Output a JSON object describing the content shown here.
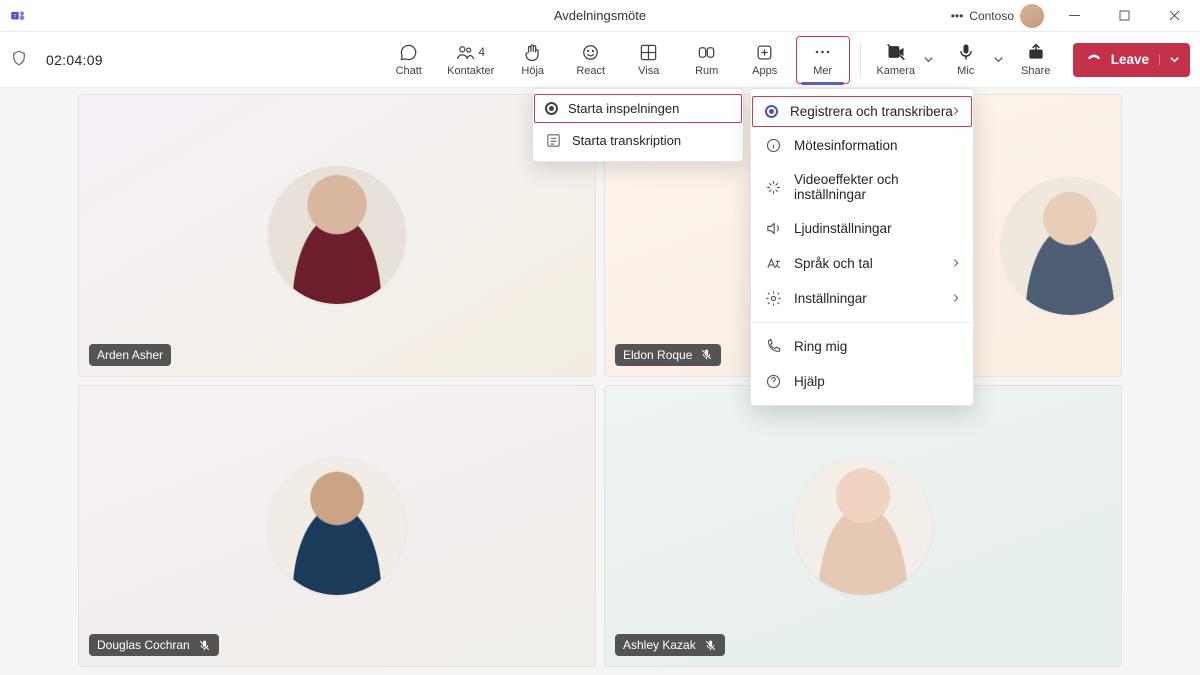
{
  "title": "Avdelningsmöte",
  "org": "Contoso",
  "timer": "02:04:09",
  "toolbar": {
    "chat": "Chatt",
    "people": "Kontakter",
    "people_count": "4",
    "raise": "Höja",
    "react": "React",
    "view": "Visa",
    "rooms": "Rum",
    "apps": "Apps",
    "more": "Mer",
    "camera": "Kamera",
    "mic": "Mic",
    "share": "Share",
    "leave": "Leave"
  },
  "submenu": {
    "start_recording": "Starta inspelningen",
    "start_transcription": "Starta transkription"
  },
  "menu": {
    "record_transcribe": "Registrera och transkribera",
    "meeting_info": "Mötesinformation",
    "video_effects": "Videoeffekter och inställningar",
    "audio_settings": "Ljudinställningar",
    "language_speech": "Språk och tal",
    "settings": "Inställningar",
    "call_me": "Ring mig",
    "help": "Hjälp"
  },
  "participants": [
    {
      "name": "Arden Asher",
      "muted": false
    },
    {
      "name": "Eldon Roque",
      "muted": true
    },
    {
      "name": "Douglas Cochran",
      "muted": true
    },
    {
      "name": "Ashley Kazak",
      "muted": true
    }
  ]
}
